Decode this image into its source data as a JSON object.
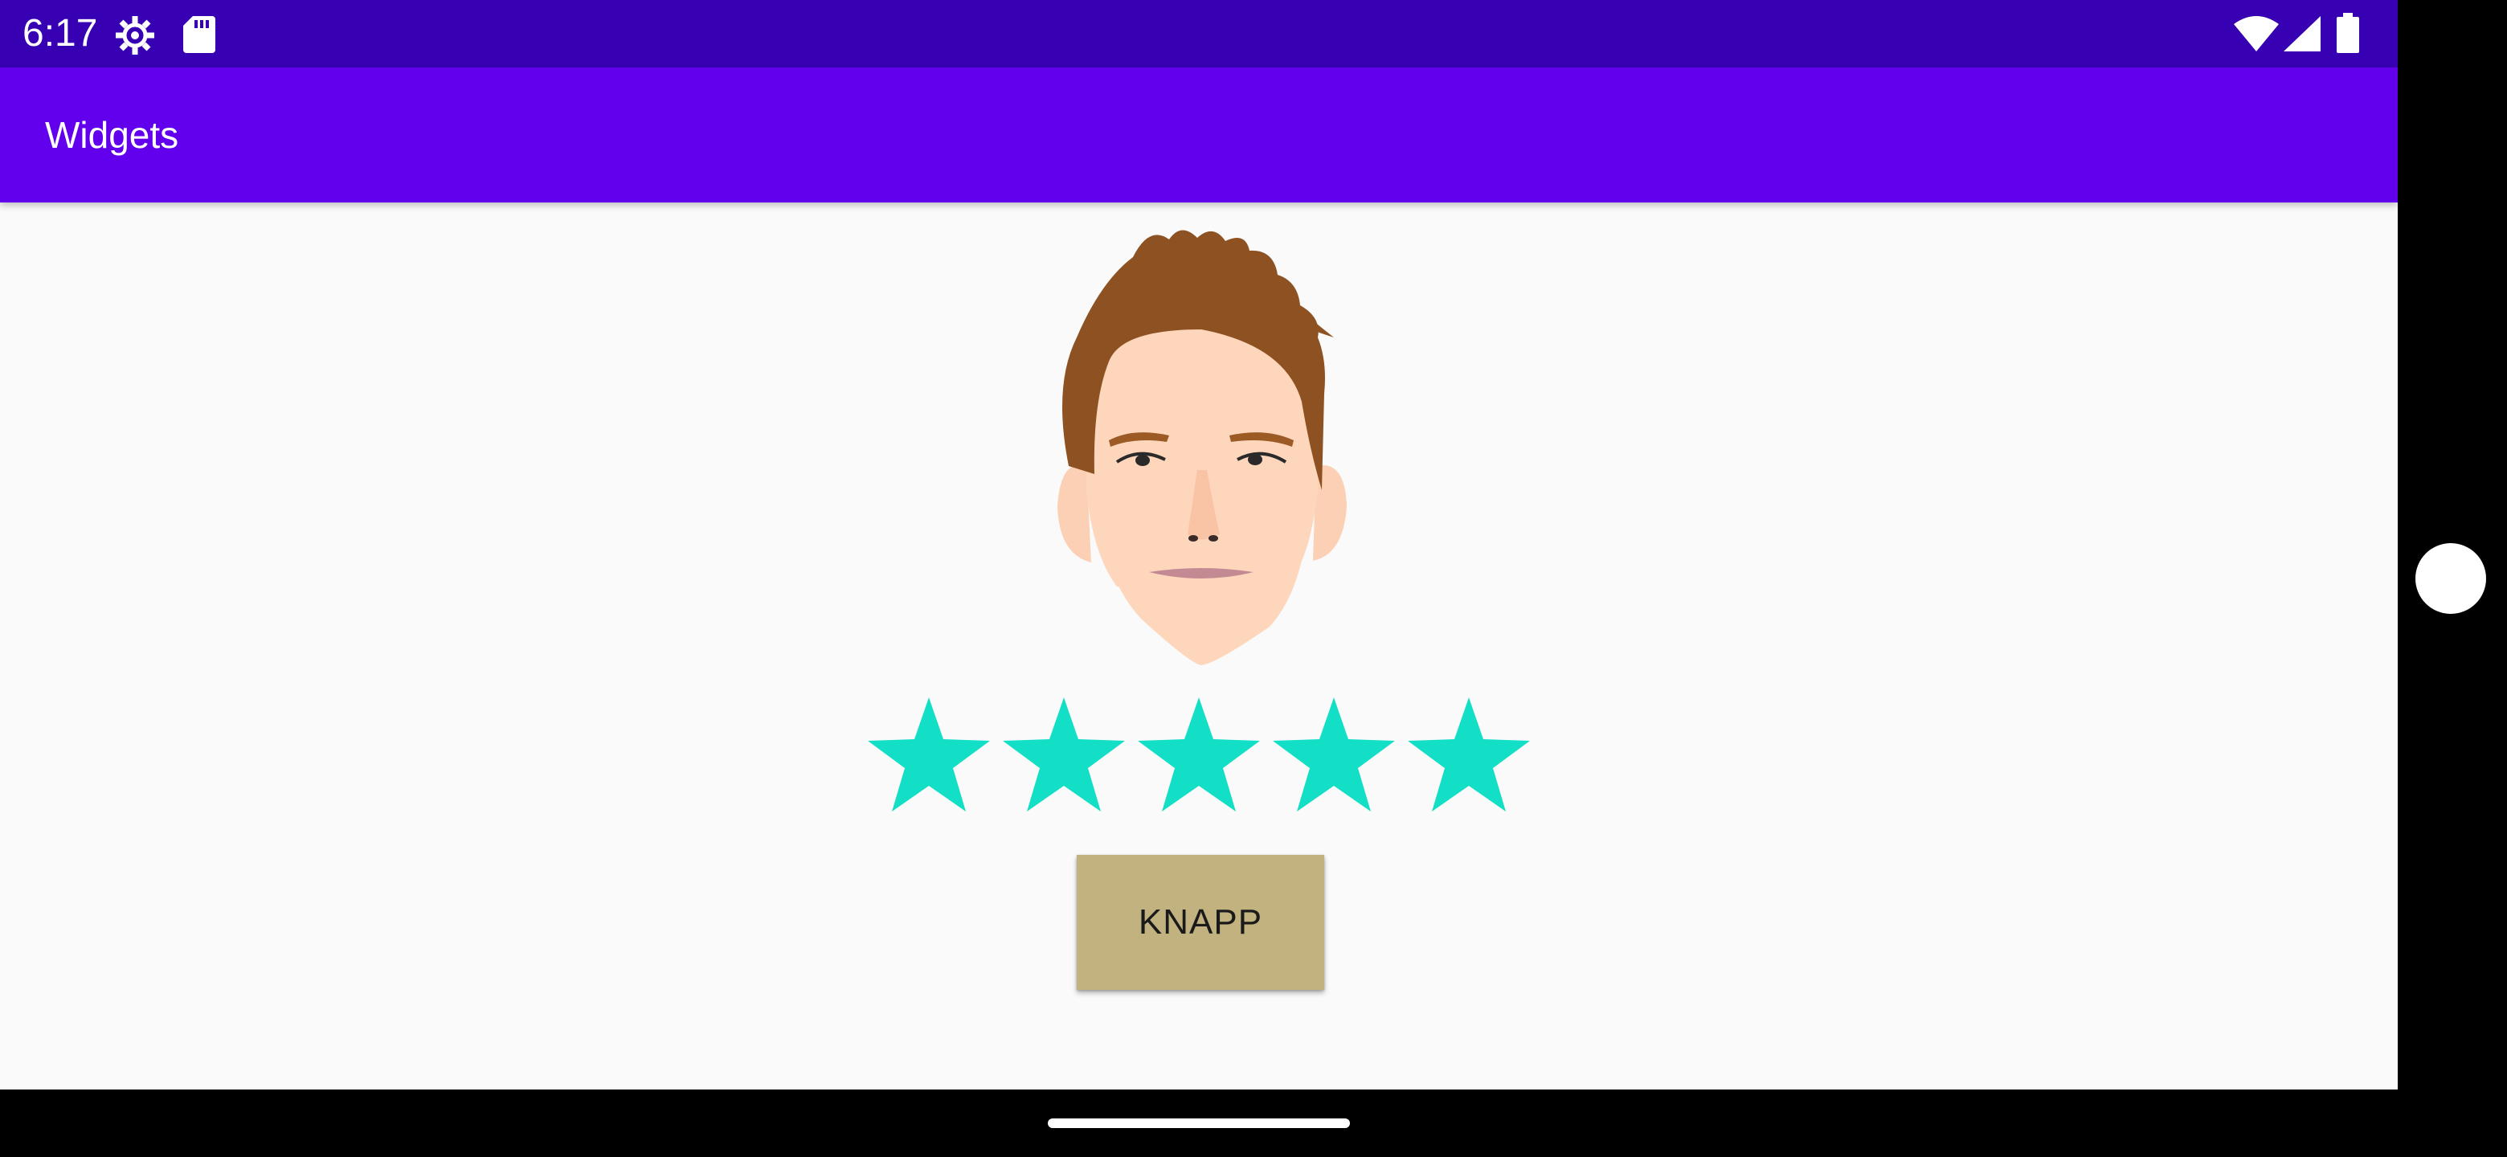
{
  "status_bar": {
    "time": "6:17",
    "icons": [
      "settings-gear-icon",
      "sd-card-icon",
      "wifi-icon",
      "cell-signal-icon",
      "battery-icon"
    ]
  },
  "app_bar": {
    "title": "Widgets"
  },
  "avatar": {
    "icon": "face-portrait-icon"
  },
  "rating": {
    "value": 5,
    "max": 5,
    "star_color": "#13dfc7"
  },
  "button": {
    "label": "KNAPP",
    "color": "#c2b280"
  },
  "colors": {
    "status_bar": "#3700b3",
    "app_bar": "#6200ee",
    "background": "#fafafa"
  }
}
